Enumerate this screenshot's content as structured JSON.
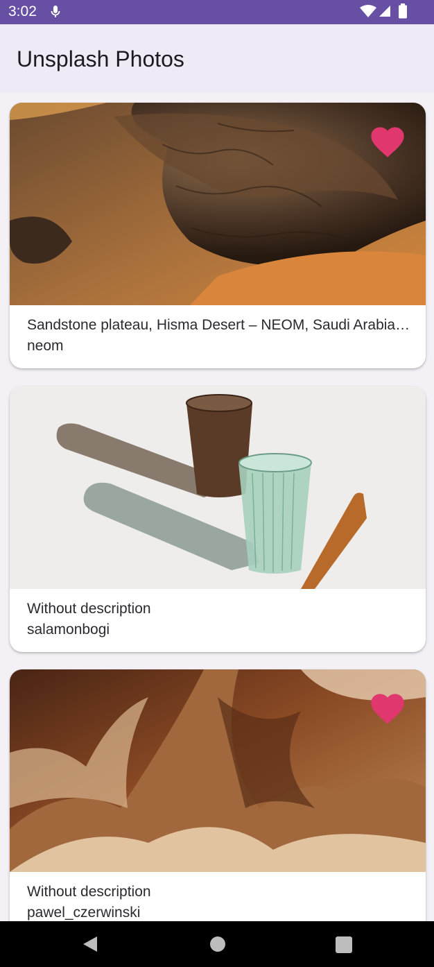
{
  "status_bar": {
    "time": "3:02",
    "icons": [
      "mic-icon",
      "wifi-icon",
      "signal-icon",
      "battery-icon"
    ]
  },
  "app_bar": {
    "title": "Unsplash Photos"
  },
  "colors": {
    "status_bar": "#6750a4",
    "app_bar": "#efeaf6",
    "heart": "#e0386e",
    "background": "#f3f1f6"
  },
  "photos": [
    {
      "description": "Sandstone plateau, Hisma Desert – NEOM, Saudi Arabia…",
      "author": "neom",
      "favorite": true
    },
    {
      "description": "Without description",
      "author": "salamonbogi",
      "favorite": false
    },
    {
      "description": "Without description",
      "author": "pawel_czerwinski",
      "favorite": true
    }
  ],
  "nav_bar": {
    "icons": [
      "back-icon",
      "home-icon",
      "recents-icon"
    ]
  }
}
